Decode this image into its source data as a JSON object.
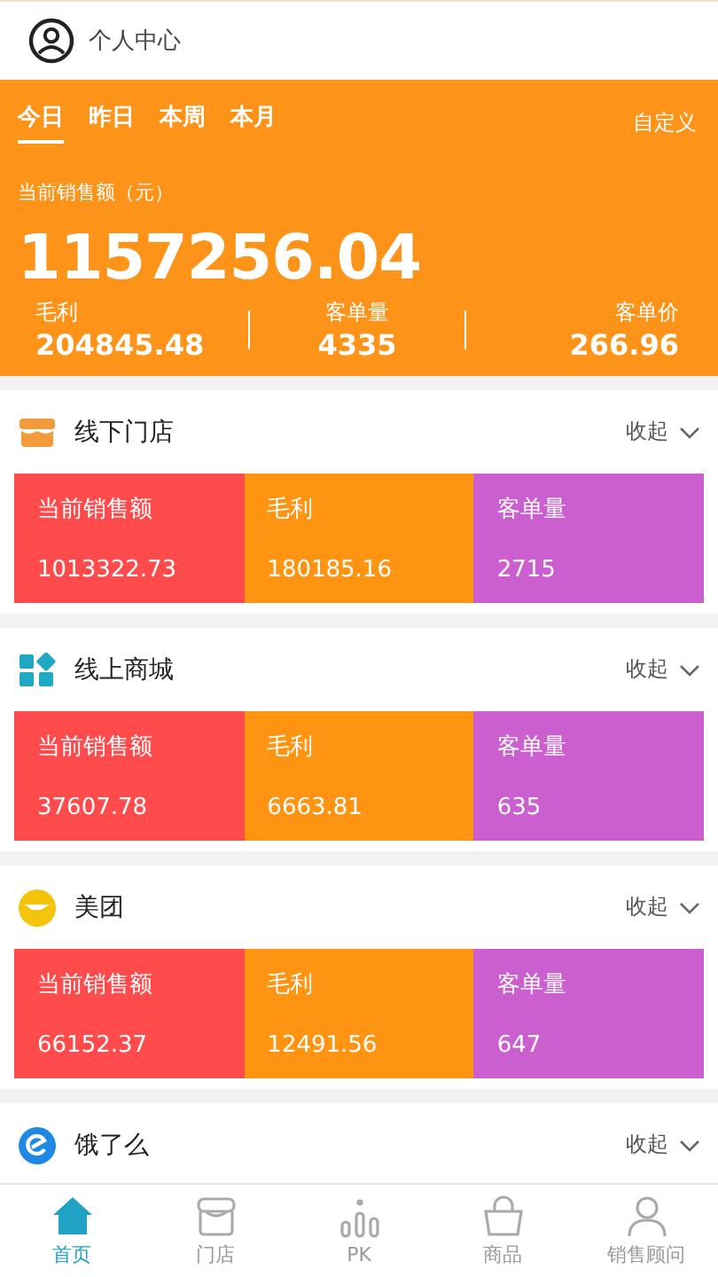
{
  "header": {
    "title": "个人中心"
  },
  "summary": {
    "periods": [
      {
        "label": "今日",
        "selected": true
      },
      {
        "label": "昨日",
        "selected": false
      },
      {
        "label": "本周",
        "selected": false
      },
      {
        "label": "本月",
        "selected": false
      }
    ],
    "custom": "自定义",
    "total_label": "当前销售额（元）",
    "total_value": "1157256.04",
    "stats": [
      {
        "label": "毛利",
        "value": "204845.48"
      },
      {
        "label": "客单量",
        "value": "4335"
      },
      {
        "label": "客单价",
        "value": "266.96"
      }
    ]
  },
  "channels": [
    {
      "kind": "store",
      "name": "线下门店",
      "toggle": "收起",
      "metrics": [
        {
          "label": "当前销售额",
          "value": "1013322.73",
          "color": "#ff4b4b"
        },
        {
          "label": "毛利",
          "value": "180185.16",
          "color": "#fe9412"
        },
        {
          "label": "客单量",
          "value": "2715",
          "color": "#cb5fcf"
        }
      ]
    },
    {
      "kind": "grid",
      "name": "线上商城",
      "toggle": "收起",
      "metrics": [
        {
          "label": "当前销售额",
          "value": "37607.78",
          "color": "#ff4b4b"
        },
        {
          "label": "毛利",
          "value": "6663.81",
          "color": "#fe9412"
        },
        {
          "label": "客单量",
          "value": "635",
          "color": "#cb5fcf"
        }
      ]
    },
    {
      "kind": "meituan",
      "name": "美团",
      "toggle": "收起",
      "metrics": [
        {
          "label": "当前销售额",
          "value": "66152.37",
          "color": "#ff4b4b"
        },
        {
          "label": "毛利",
          "value": "12491.56",
          "color": "#fe9412"
        },
        {
          "label": "客单量",
          "value": "647",
          "color": "#cb5fcf"
        }
      ]
    },
    {
      "kind": "eleme",
      "name": "饿了么",
      "toggle": "收起"
    }
  ],
  "tabbar": [
    {
      "kind": "home",
      "label": "首页",
      "selected": true
    },
    {
      "kind": "store",
      "label": "门店",
      "selected": false
    },
    {
      "kind": "pk",
      "label": "PK",
      "selected": false
    },
    {
      "kind": "bag",
      "label": "商品",
      "selected": false
    },
    {
      "kind": "person",
      "label": "销售顾问",
      "selected": false
    }
  ]
}
